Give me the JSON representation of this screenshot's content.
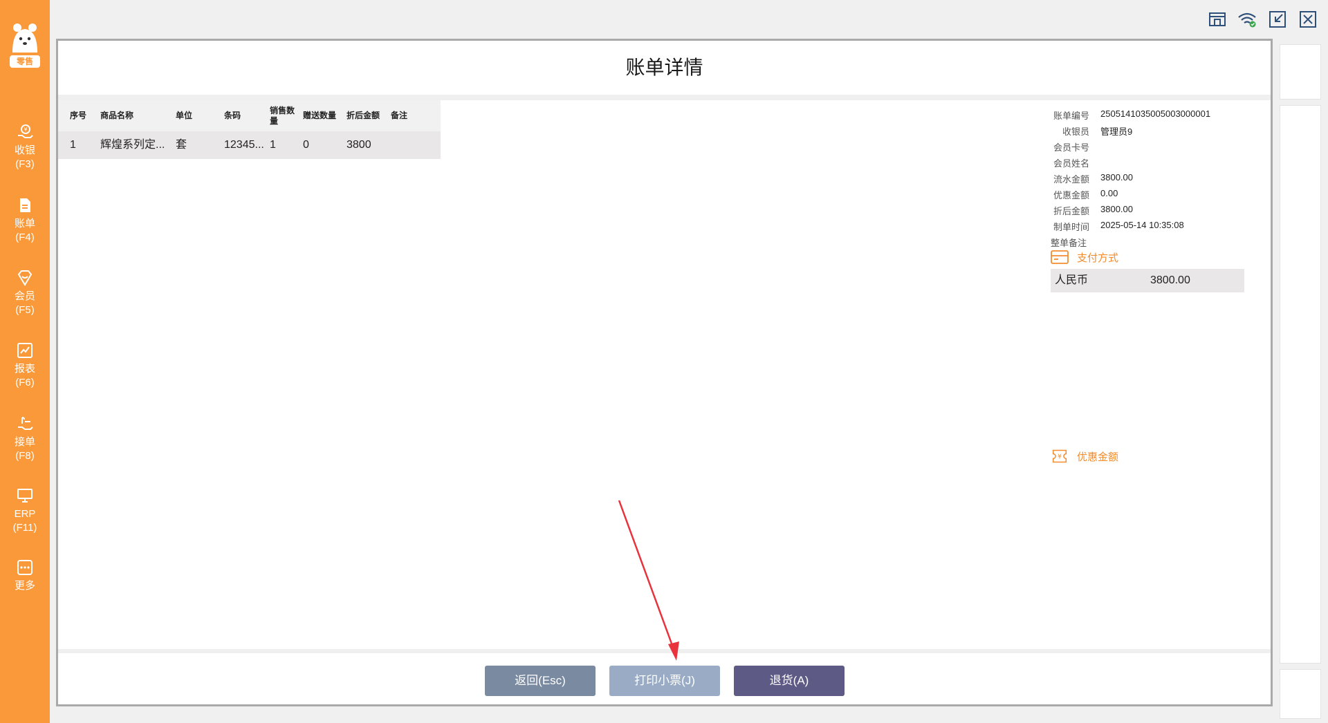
{
  "colors": {
    "brand": "#f99939",
    "accent": "#f28c2e",
    "btn_back": "#7a8aa1",
    "btn_print": "#9aabc6",
    "btn_return": "#5d5b85",
    "annotation": "#e8323c"
  },
  "sidebar": {
    "logo_text": "零售",
    "items": [
      {
        "icon": "cashier-icon",
        "label": "收银",
        "key": "(F3)"
      },
      {
        "icon": "bill-icon",
        "label": "账单",
        "key": "(F4)"
      },
      {
        "icon": "member-icon",
        "label": "会员",
        "key": "(F5)"
      },
      {
        "icon": "report-icon",
        "label": "报表",
        "key": "(F6)"
      },
      {
        "icon": "order-icon",
        "label": "接单",
        "key": "(F8)"
      },
      {
        "icon": "erp-icon",
        "label": "ERP",
        "key": "(F11)"
      },
      {
        "icon": "more-icon",
        "label": "更多",
        "key": ""
      }
    ]
  },
  "window_controls": [
    "store-icon",
    "wifi-icon",
    "shrink-icon",
    "close-icon"
  ],
  "modal": {
    "title": "账单详情",
    "table": {
      "headers": [
        "序号",
        "商品名称",
        "单位",
        "条码",
        "销售数量",
        "赠送数量",
        "折后金额",
        "备注"
      ],
      "rows": [
        {
          "index": "1",
          "name": "辉煌系列定...",
          "unit": "套",
          "barcode": "12345...",
          "qty": "1",
          "gift": "0",
          "amount": "3800",
          "note": ""
        }
      ]
    },
    "info": {
      "bill_no_label": "账单编号",
      "bill_no": "2505141035005003000001",
      "cashier_label": "收银员",
      "cashier": "管理员9",
      "card_label": "会员卡号",
      "card": "",
      "member_name_label": "会员姓名",
      "member_name": "",
      "flow_label": "流水金额",
      "flow": "3800.00",
      "discount_label": "优惠金额",
      "discount": "0.00",
      "after_label": "折后金额",
      "after": "3800.00",
      "time_label": "制单时间",
      "time": "2025-05-14 10:35:08",
      "remark_label": "整单备注"
    },
    "payment": {
      "section_title": "支付方式",
      "method": "人民币",
      "amount": "3800.00"
    },
    "discount_section_title": "优惠金额",
    "buttons": {
      "back": "返回(Esc)",
      "print": "打印小票(J)",
      "return_goods": "退货(A)"
    }
  }
}
